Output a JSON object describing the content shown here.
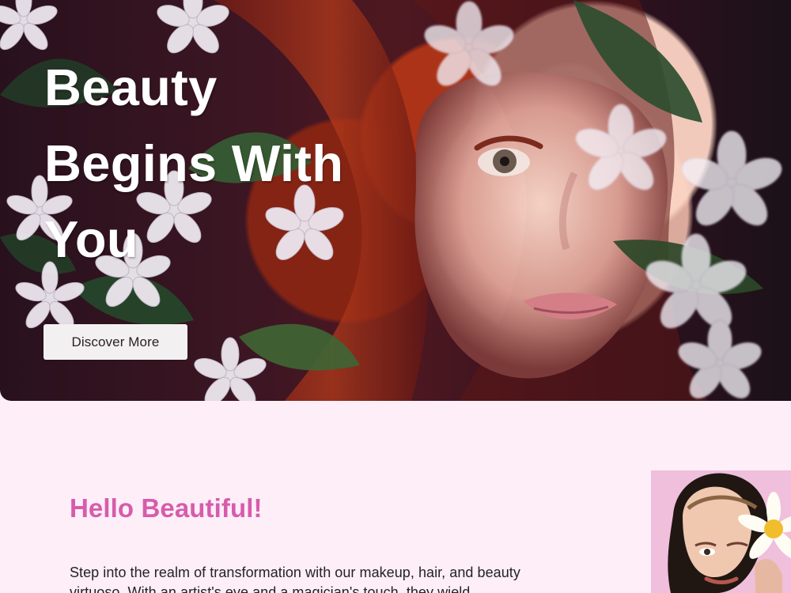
{
  "hero": {
    "title": "Beauty Begins With You",
    "cta_label": "Discover More"
  },
  "intro": {
    "title": "Hello Beautiful!",
    "copy": "Step into the realm of transformation with our makeup, hair, and beauty virtuoso. With an artist's eye and a magician's touch, they wield brushes"
  },
  "images": {
    "hero": "hero-flowers-redhead-image",
    "portrait": "woman-with-daisy-portrait"
  },
  "colors": {
    "hero_heading": "#ffffff",
    "accent_pink": "#d75cab",
    "page_background": "#fdeef8",
    "button_background": "#f3f0f1",
    "body_text": "#232228"
  }
}
